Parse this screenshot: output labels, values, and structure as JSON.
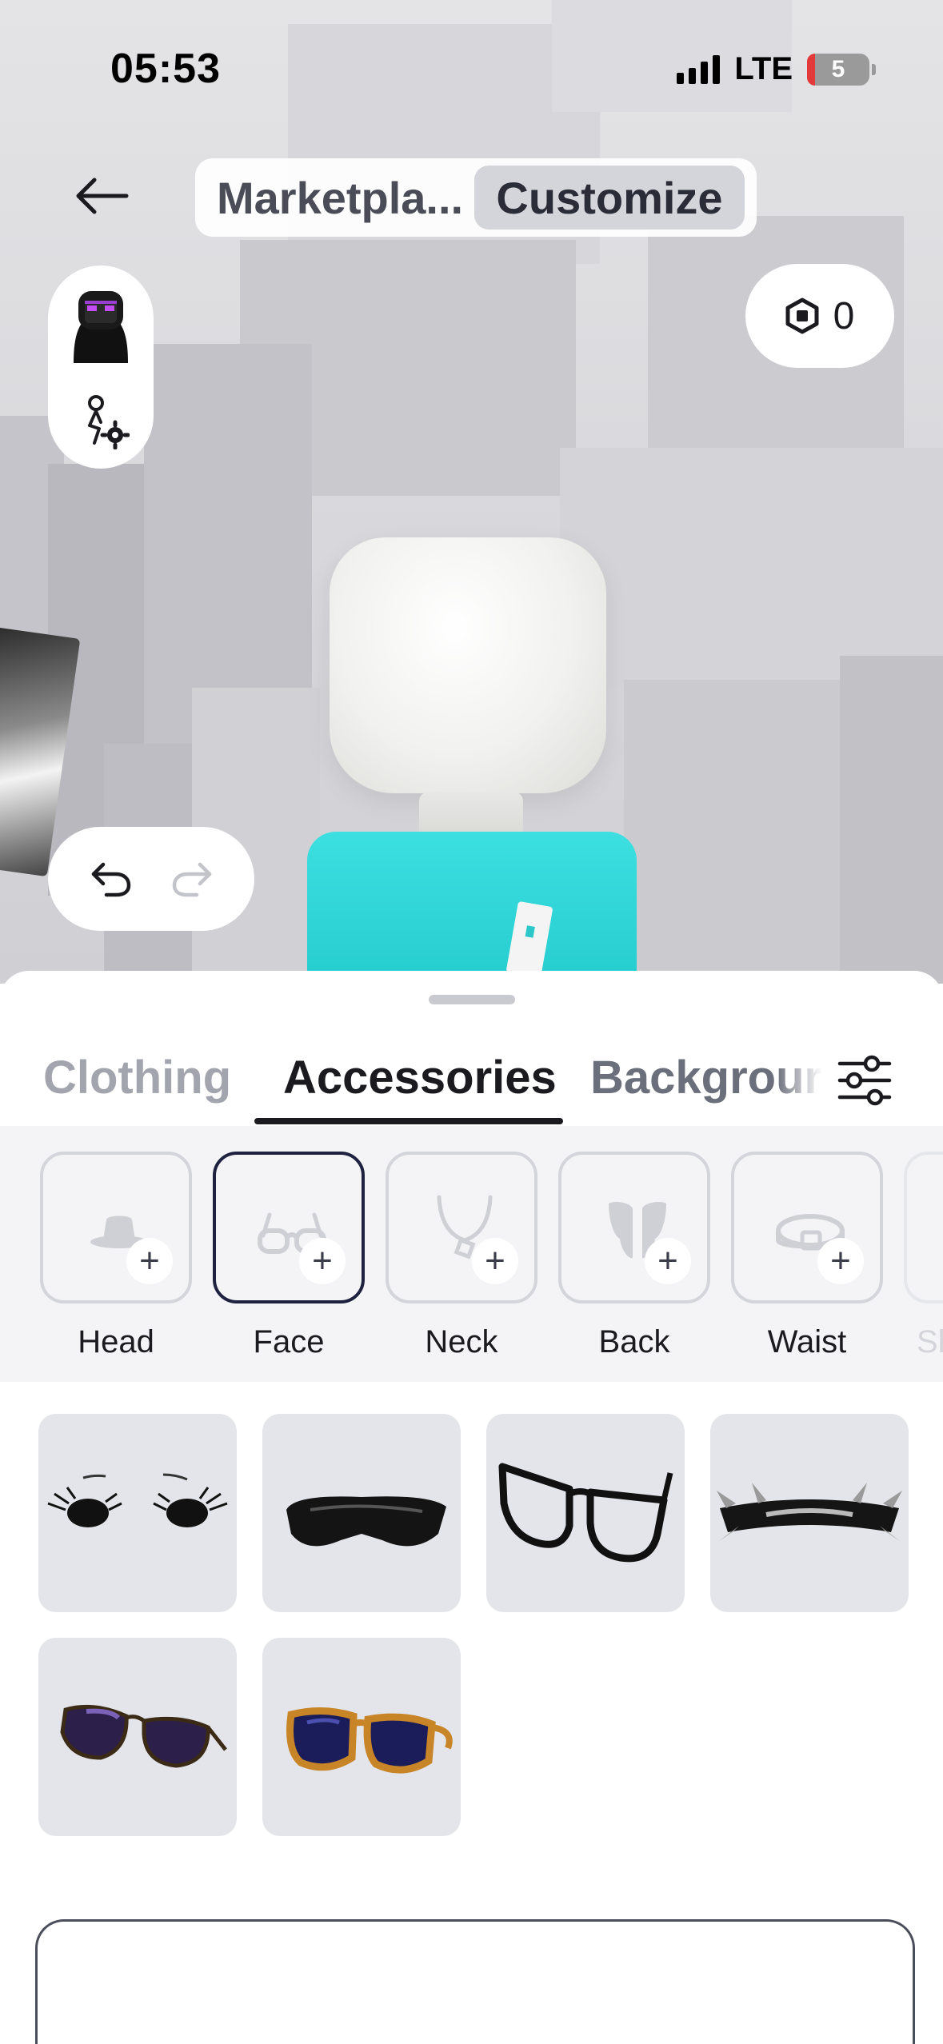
{
  "status_bar": {
    "time": "05:53",
    "network": "LTE",
    "battery": "5"
  },
  "top_nav": {
    "tab_marketplace": "Marketpla...",
    "tab_customize": "Customize"
  },
  "robux": {
    "amount": "0"
  },
  "sheet": {
    "tabs": [
      "Clothing",
      "Accessories",
      "Backgrour"
    ],
    "active_tab": "Accessories",
    "categories": [
      {
        "label": "Head",
        "icon": "hat-icon"
      },
      {
        "label": "Face",
        "icon": "glasses-icon",
        "selected": true
      },
      {
        "label": "Neck",
        "icon": "necklace-icon"
      },
      {
        "label": "Back",
        "icon": "wings-icon"
      },
      {
        "label": "Waist",
        "icon": "belt-icon"
      },
      {
        "label": "Sh",
        "icon": "shoulder-icon"
      }
    ],
    "items": [
      {
        "icon": "lashes-icon"
      },
      {
        "icon": "black-visor-icon"
      },
      {
        "icon": "black-frame-glasses-icon"
      },
      {
        "icon": "spiked-visor-icon"
      },
      {
        "icon": "aviator-sunglasses-icon"
      },
      {
        "icon": "orange-goggles-icon"
      }
    ]
  },
  "colors": {
    "accent_selected": "#1e2240",
    "torso": "#2ad4d6"
  }
}
